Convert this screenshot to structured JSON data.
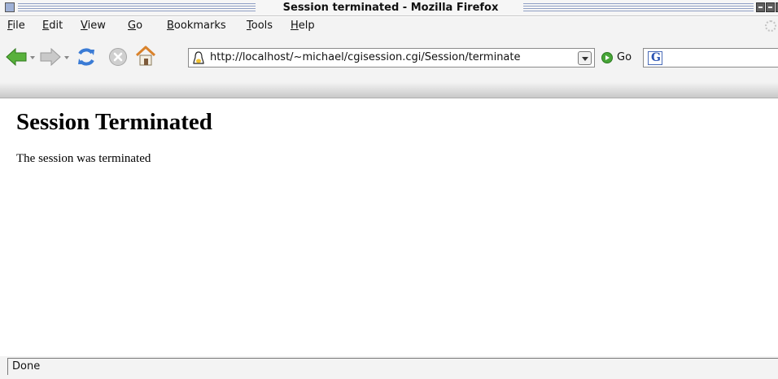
{
  "window": {
    "title": "Session terminated - Mozilla Firefox"
  },
  "menubar": {
    "items": [
      "File",
      "Edit",
      "View",
      "Go",
      "Bookmarks",
      "Tools",
      "Help"
    ]
  },
  "toolbar": {
    "back_icon": "back-arrow-icon",
    "forward_icon": "forward-arrow-icon",
    "reload_icon": "reload-icon",
    "stop_icon": "stop-icon",
    "home_icon": "home-icon",
    "url": "http://localhost/~michael/cgisession.cgi/Session/terminate",
    "go_label": "Go",
    "search_engine_icon": "google-icon",
    "search_engine_letter": "G"
  },
  "page": {
    "heading": "Session Terminated",
    "body_text": "The session was terminated"
  },
  "status": {
    "text": "Done"
  },
  "colors": {
    "back_arrow": "#58b13b",
    "forward_arrow": "#b9b9b9",
    "reload": "#3a7bd5",
    "stop": "#c7c7c7",
    "go": "#47a537",
    "home_roof": "#d9822b"
  }
}
